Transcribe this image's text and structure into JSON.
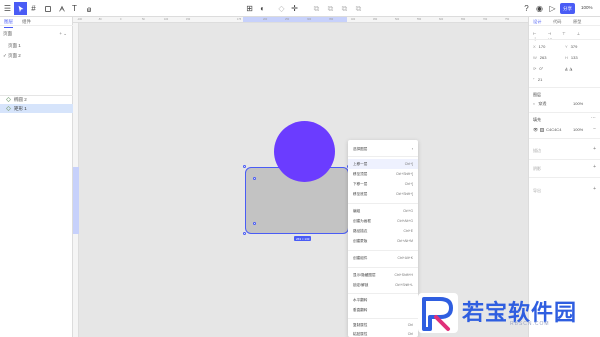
{
  "colors": {
    "accent": "#4a5cf5",
    "circle_fill": "#6b3cff",
    "rect_fill": "#c3c3c3",
    "watermark": "#2f5ee0"
  },
  "toolbar": {
    "left_icons": [
      "menu-icon",
      "move-tool-icon",
      "frame-tool-icon",
      "rectangle-tool-icon",
      "pen-tool-icon",
      "text-tool-icon",
      "hand-tool-icon"
    ],
    "center_icons": [
      "component-icon",
      "mask-icon",
      "boolean-icon",
      "link-icon",
      "align-icon"
    ],
    "share_label": "分享",
    "zoom_label": "100%"
  },
  "left_panel": {
    "tabs": [
      "图层",
      "组件"
    ],
    "pages_title": "页面",
    "pages_actions": "+ ⌄",
    "pages": [
      {
        "label": "页面 1",
        "checked": false
      },
      {
        "label": "页面 2",
        "checked": true
      }
    ],
    "layers": [
      {
        "label": "椭圆 2",
        "selected": false
      },
      {
        "label": "矩形 1",
        "selected": true
      }
    ]
  },
  "ruler": {
    "top_ticks": [
      "-100",
      "-50",
      "0",
      "50",
      "100",
      "150",
      "175",
      "200",
      "250",
      "300",
      "350",
      "400",
      "450",
      "500",
      "550",
      "600",
      "650",
      "700",
      "750",
      "800",
      "850",
      "900"
    ],
    "left_ticks": [
      "100",
      "150",
      "200",
      "250",
      "300",
      "350",
      "400",
      "450",
      "500",
      "550",
      "600"
    ]
  },
  "canvas": {
    "size_badge": "263 × 133"
  },
  "context_menu": {
    "header": "选择图层",
    "items": [
      {
        "label": "上移一层",
        "shortcut": "Ctrl+]",
        "hover": true
      },
      {
        "label": "移至顶层",
        "shortcut": "Ctrl+Shift+]"
      },
      {
        "label": "下移一层",
        "shortcut": "Ctrl+["
      },
      {
        "label": "移至底层",
        "shortcut": "Ctrl+Shift+["
      },
      {
        "label": "编组",
        "shortcut": "Ctrl+G"
      },
      {
        "label": "创建为画框",
        "shortcut": "Ctrl+Alt+G"
      },
      {
        "label": "路径描边",
        "shortcut": "Ctrl+E"
      },
      {
        "label": "创建蒙版",
        "shortcut": "Ctrl+Alt+M"
      },
      {
        "label": "创建组件",
        "shortcut": "Ctrl+Alt+K"
      },
      {
        "label": "显示/隐藏图层",
        "shortcut": "Ctrl+Shift+H"
      },
      {
        "label": "锁定/解锁",
        "shortcut": "Ctrl+Shift+L"
      },
      {
        "label": "水平翻转",
        "shortcut": ""
      },
      {
        "label": "垂直翻转",
        "shortcut": ""
      },
      {
        "label": "复制属性",
        "shortcut": "Ctrl"
      },
      {
        "label": "粘贴属性",
        "shortcut": "Ctrl"
      }
    ]
  },
  "right_panel": {
    "tabs": [
      "设计",
      "代码",
      "原型"
    ],
    "x": "170",
    "y": "379",
    "w": "263",
    "h": "133",
    "rotation": "0°",
    "radius": "21",
    "layer_title": "图层",
    "blend_mode": "穿透",
    "opacity": "100%",
    "fill_title": "填充",
    "fill_hex": "C4C4C4",
    "fill_opacity": "100%",
    "stroke_title": "描边",
    "effects_title": "阴影",
    "export_title": "导出"
  },
  "watermark": {
    "text": "若宝软件园",
    "sub": "RBSCN.COM"
  }
}
